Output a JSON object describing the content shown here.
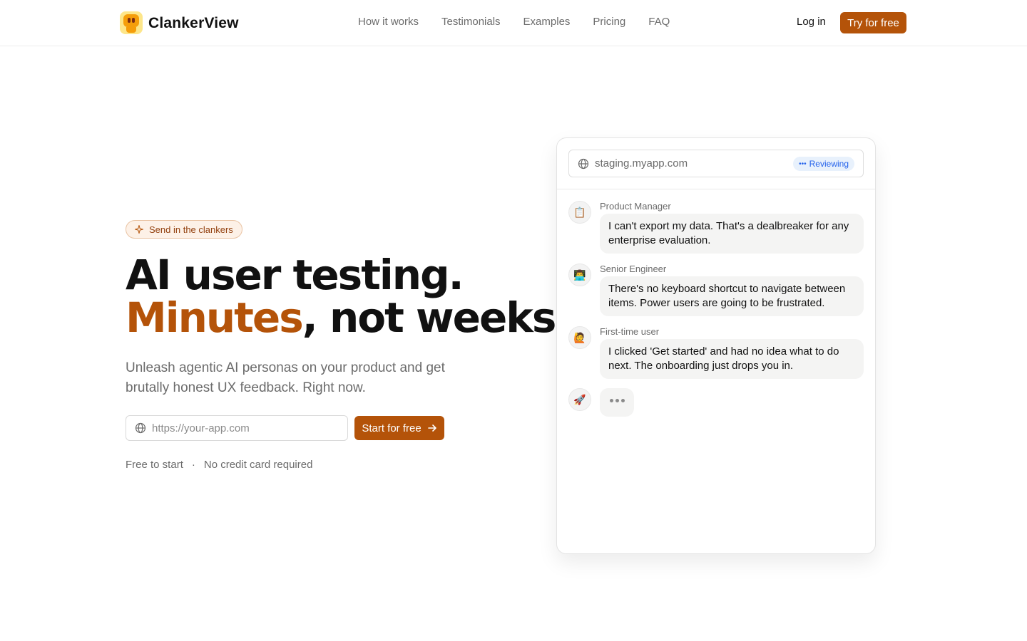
{
  "header": {
    "brand": "ClankerView",
    "nav": [
      "How it works",
      "Testimonials",
      "Examples",
      "Pricing",
      "FAQ"
    ],
    "login_label": "Log in",
    "try_label": "Try for free"
  },
  "hero": {
    "badge": "Send in the clankers",
    "headline_line1": "AI user testing.",
    "headline_accent": "Minutes",
    "headline_rest": ", not weeks.",
    "subhead": "Unleash agentic AI personas on your product and get brutally honest UX feedback. Right now.",
    "url_placeholder": "https://your-app.com",
    "start_label": "Start for free",
    "perk_1": "Free to start",
    "perk_sep": "·",
    "perk_2": "No credit card required"
  },
  "panel": {
    "address": "staging.myapp.com",
    "status": "Reviewing",
    "messages": [
      {
        "role": "Product Manager",
        "icon": "clipboard-icon",
        "emoji": "📋",
        "text": "I can't export my data. That's a dealbreaker for any enterprise evaluation."
      },
      {
        "role": "Senior Engineer",
        "icon": "technologist-icon",
        "emoji": "👨‍💻",
        "text": "There's no keyboard shortcut to navigate between items. Power users are going to be frustrated."
      },
      {
        "role": "First-time user",
        "icon": "person-raising-hand-icon",
        "emoji": "🙋",
        "text": "I clicked 'Get started' and had no idea what to do next. The onboarding just drops you in."
      }
    ],
    "typing_avatar": {
      "icon": "rocket-icon",
      "emoji": "🚀"
    }
  },
  "colors": {
    "accent": "#b45309",
    "status_blue": "#2563eb"
  }
}
